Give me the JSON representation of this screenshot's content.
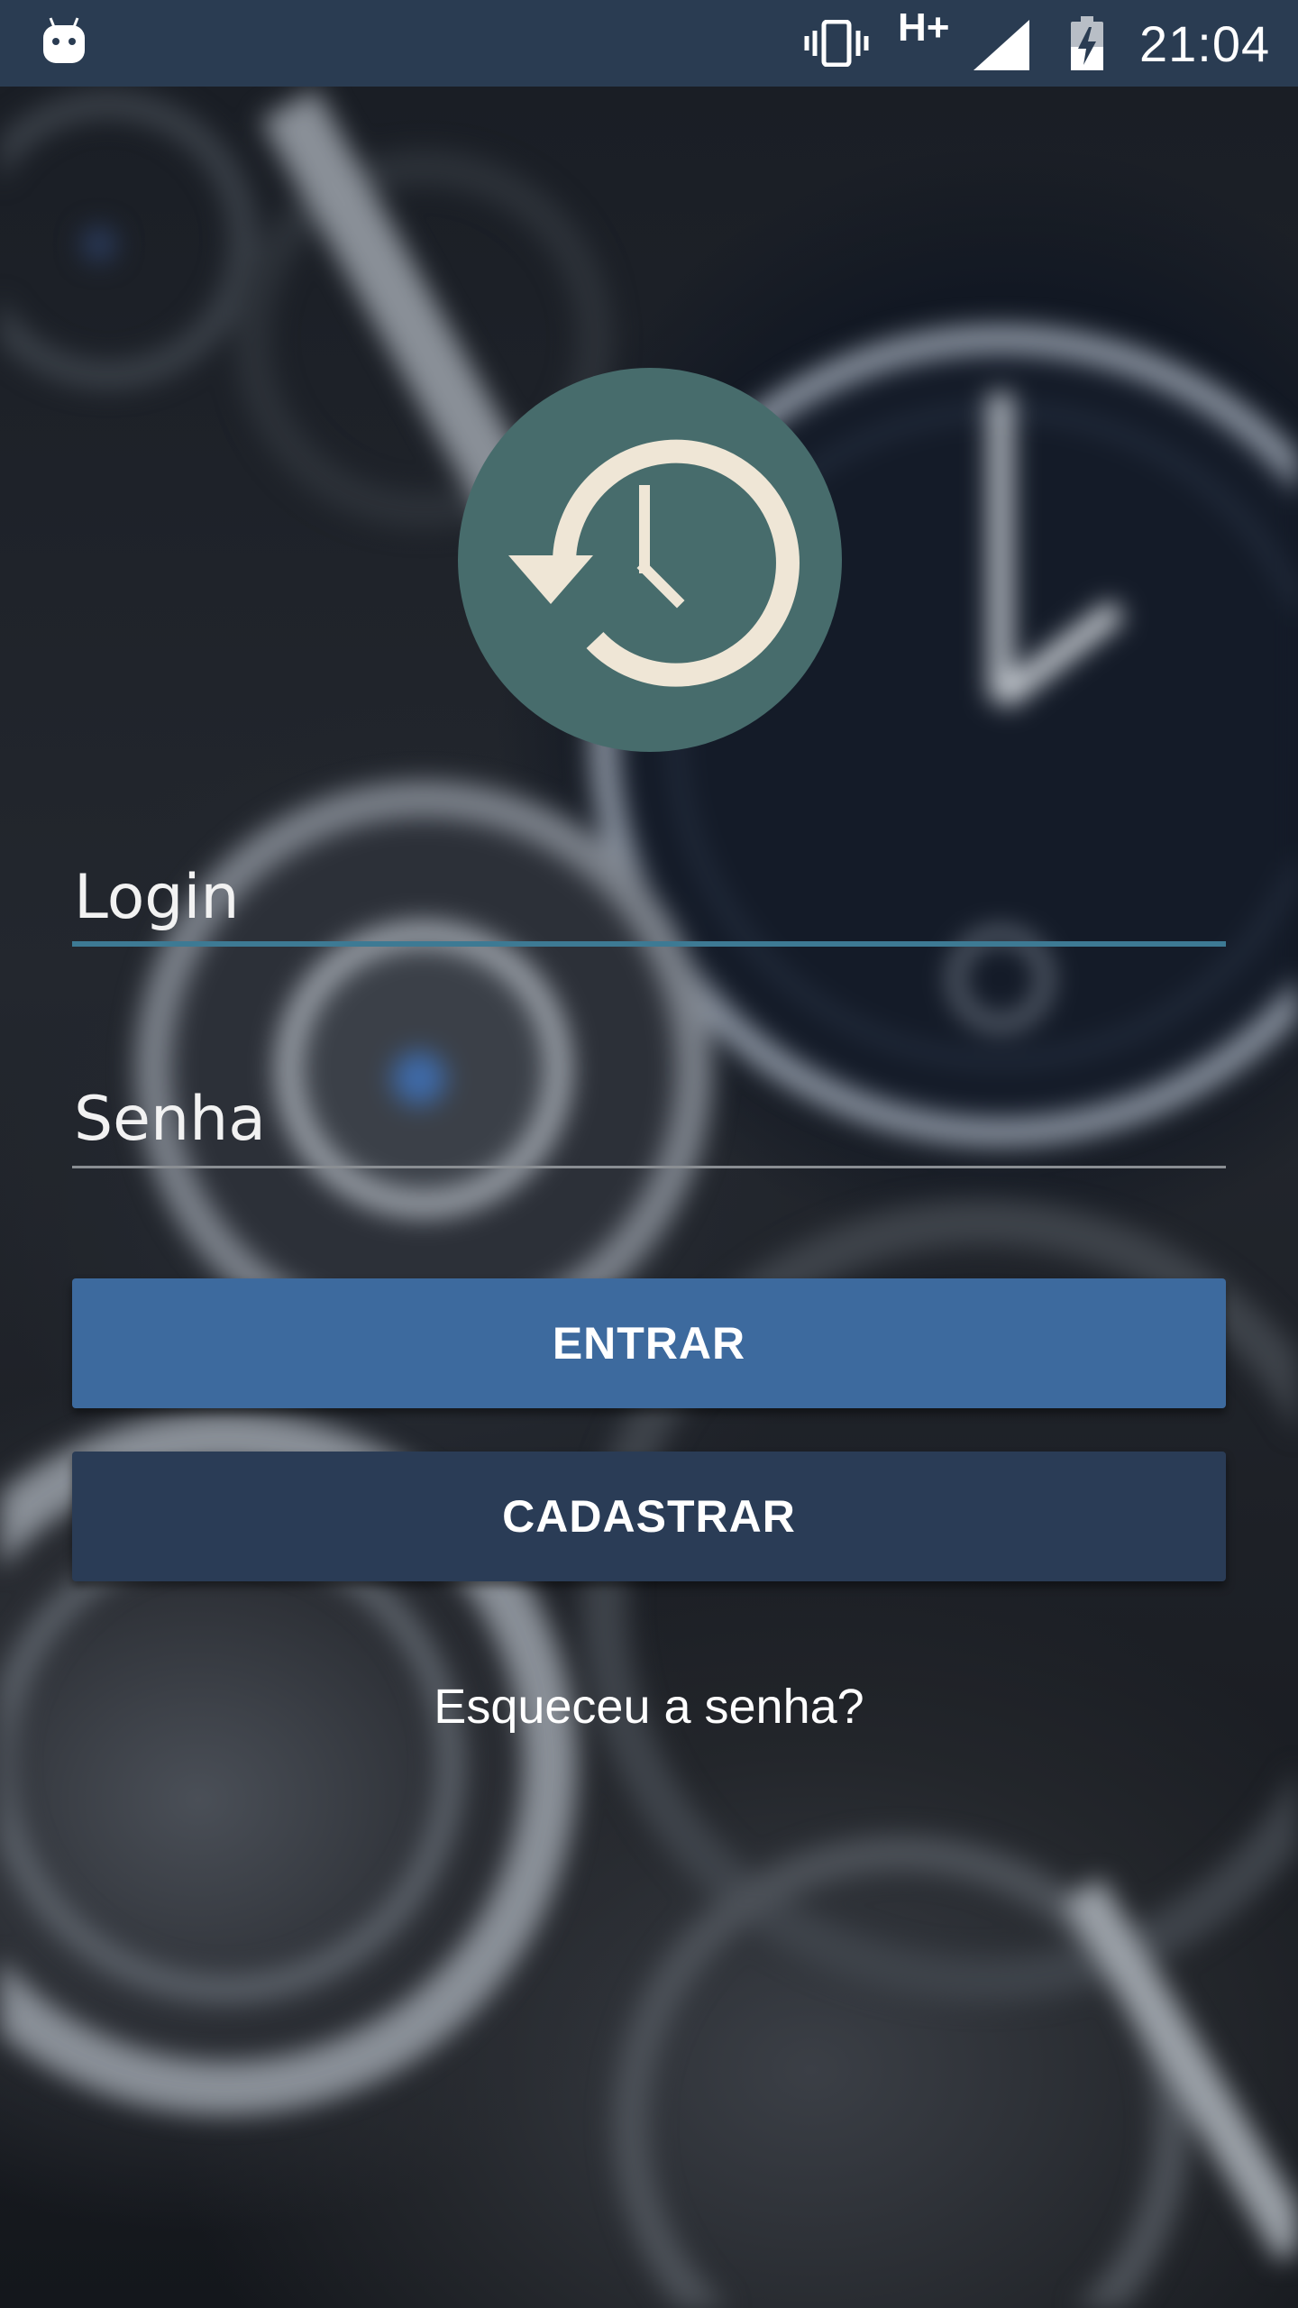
{
  "status_bar": {
    "network_type": "H+",
    "time": "21:04",
    "icons": [
      "android-notification-icon",
      "vibrate-icon",
      "signal-icon",
      "battery-charging-icon"
    ]
  },
  "logo": {
    "icon": "history-clock-icon",
    "circle_color": "#476c6c",
    "glyph_color": "#efe6d6"
  },
  "form": {
    "login_placeholder": "Login",
    "login_value": "",
    "password_placeholder": "Senha",
    "password_value": "",
    "login_button": "ENTRAR",
    "register_button": "CADASTRAR",
    "forgot_link": "Esqueceu a senha?"
  },
  "colors": {
    "status_bar": "#2a3c52",
    "entrar_button": "#3d6a9e",
    "cadastrar_button": "#2a3c56",
    "focused_underline": "#3d7a94"
  }
}
